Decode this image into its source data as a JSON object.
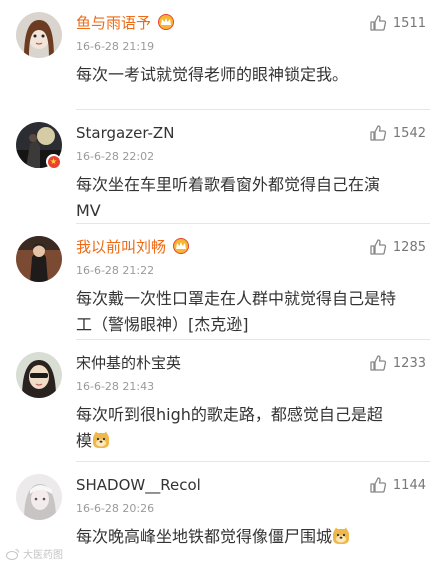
{
  "comments": [
    {
      "username": "鱼与雨语予",
      "vip": true,
      "time": "16-6-28 21:19",
      "likes": "1511",
      "text": "每次一考试就觉得老师的眼神锁定我。"
    },
    {
      "username": "Stargazer-ZN",
      "vip": false,
      "verified": true,
      "time": "16-6-28 22:02",
      "likes": "1542",
      "text": "每次坐在车里听着歌看窗外都觉得自己在演MV"
    },
    {
      "username": "我以前叫刘畅",
      "vip": true,
      "time": "16-6-28 21:22",
      "likes": "1285",
      "text": "每次戴一次性口罩走在人群中就觉得自己是特工（警惕眼神）[杰克逊]"
    },
    {
      "username": "宋仲基的朴宝英",
      "vip": false,
      "time": "16-6-28 21:43",
      "likes": "1233",
      "text": "每次听到很high的歌走路，都感觉自己是超模",
      "emoji": "doge-emoji"
    },
    {
      "username": "SHADOW__Recol",
      "vip": false,
      "time": "16-6-28 20:26",
      "likes": "1144",
      "text": "每次晚高峰坐地铁都觉得像僵尸围城",
      "emoji": "doge-emoji"
    }
  ],
  "watermark": {
    "text": "大医药图"
  },
  "colors": {
    "vip_name": "#ee6a14",
    "text": "#333333",
    "meta": "#9a9a9a"
  }
}
